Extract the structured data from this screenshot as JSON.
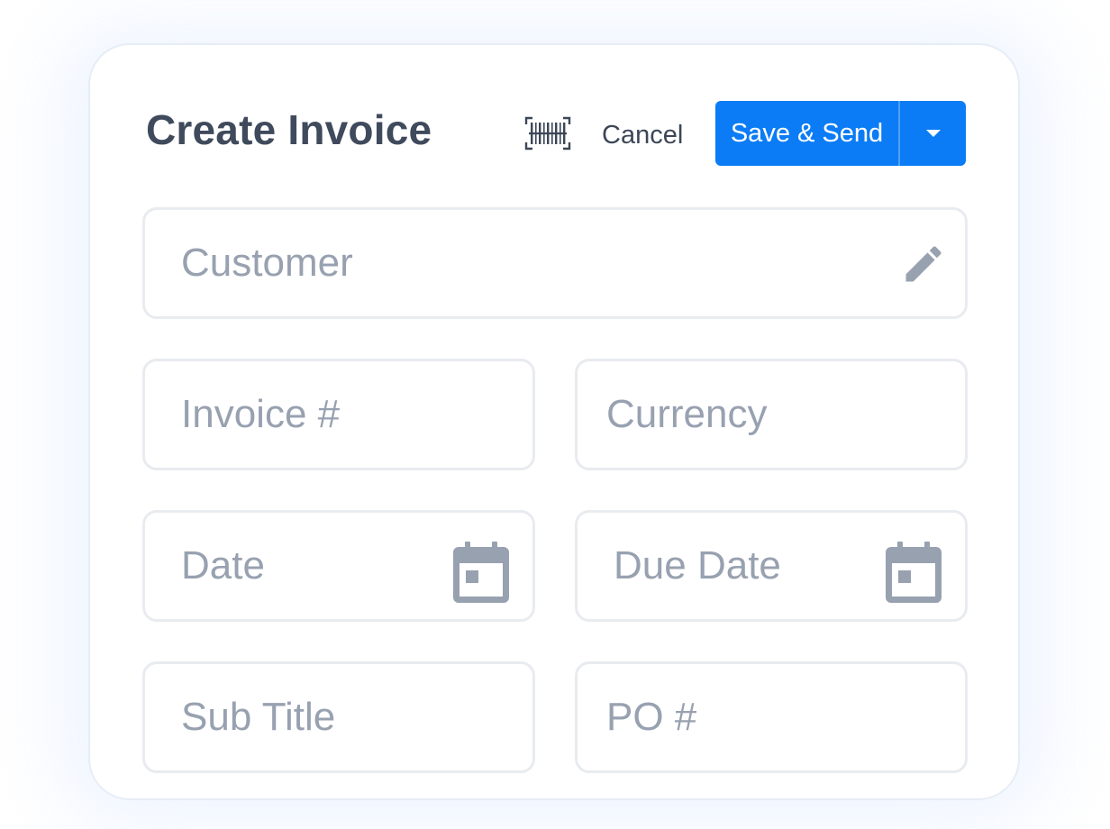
{
  "header": {
    "title": "Create Invoice",
    "cancel_label": "Cancel",
    "save_send_label": "Save & Send"
  },
  "fields": {
    "customer": {
      "placeholder": "Customer",
      "icon": "pencil-icon"
    },
    "invoice_number": {
      "placeholder": "Invoice #"
    },
    "currency": {
      "placeholder": "Currency"
    },
    "date": {
      "placeholder": "Date",
      "icon": "calendar-icon"
    },
    "due_date": {
      "placeholder": "Due Date",
      "icon": "calendar-icon"
    },
    "sub_title": {
      "placeholder": "Sub Title"
    },
    "po_number": {
      "placeholder": "PO #"
    }
  },
  "icons": {
    "scan": "barcode-scan-icon",
    "dropdown": "caret-down-icon"
  },
  "colors": {
    "accent": "#0b7cf5",
    "title": "#3f4a5c",
    "placeholder": "#98a1b0",
    "icon": "#98a1b0",
    "field_border": "#e8ebef"
  }
}
